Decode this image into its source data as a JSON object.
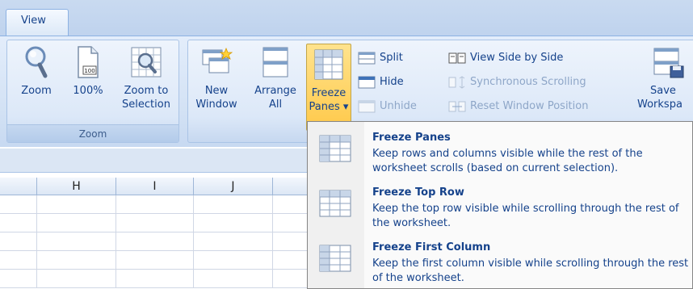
{
  "tabs": {
    "active_label": "View"
  },
  "ribbon": {
    "zoom_group": {
      "label": "Zoom",
      "buttons": {
        "zoom": "Zoom",
        "hundred": "100%",
        "zoom_to_line1": "Zoom to",
        "zoom_to_line2": "Selection"
      }
    },
    "window_group": {
      "new_window_line1": "New",
      "new_window_line2": "Window",
      "arrange_all_line1": "Arrange",
      "arrange_all_line2": "All",
      "freeze_panes_line1": "Freeze",
      "freeze_panes_line2": "Panes ▾",
      "split": "Split",
      "hide": "Hide",
      "unhide": "Unhide",
      "view_side_by_side": "View Side by Side",
      "synchronous_scrolling": "Synchronous Scrolling",
      "reset_window_position": "Reset Window Position",
      "save_workspace_line1": "Save",
      "save_workspace_line2": "Workspa"
    }
  },
  "sheet": {
    "columns": [
      "H",
      "I",
      "J"
    ]
  },
  "menu": {
    "items": [
      {
        "title": "Freeze Panes",
        "description": "Keep rows and columns visible while the rest of the worksheet scrolls (based on current selection)."
      },
      {
        "title": "Freeze Top Row",
        "description": "Keep the top row visible while scrolling through the rest of the worksheet."
      },
      {
        "title": "Freeze First Column",
        "description": "Keep the first column visible while scrolling through the rest of the worksheet."
      }
    ]
  },
  "colors": {
    "accent_text": "#15428b",
    "active_button": "#ffc94a",
    "ribbon_bg": "#dce8f8"
  }
}
